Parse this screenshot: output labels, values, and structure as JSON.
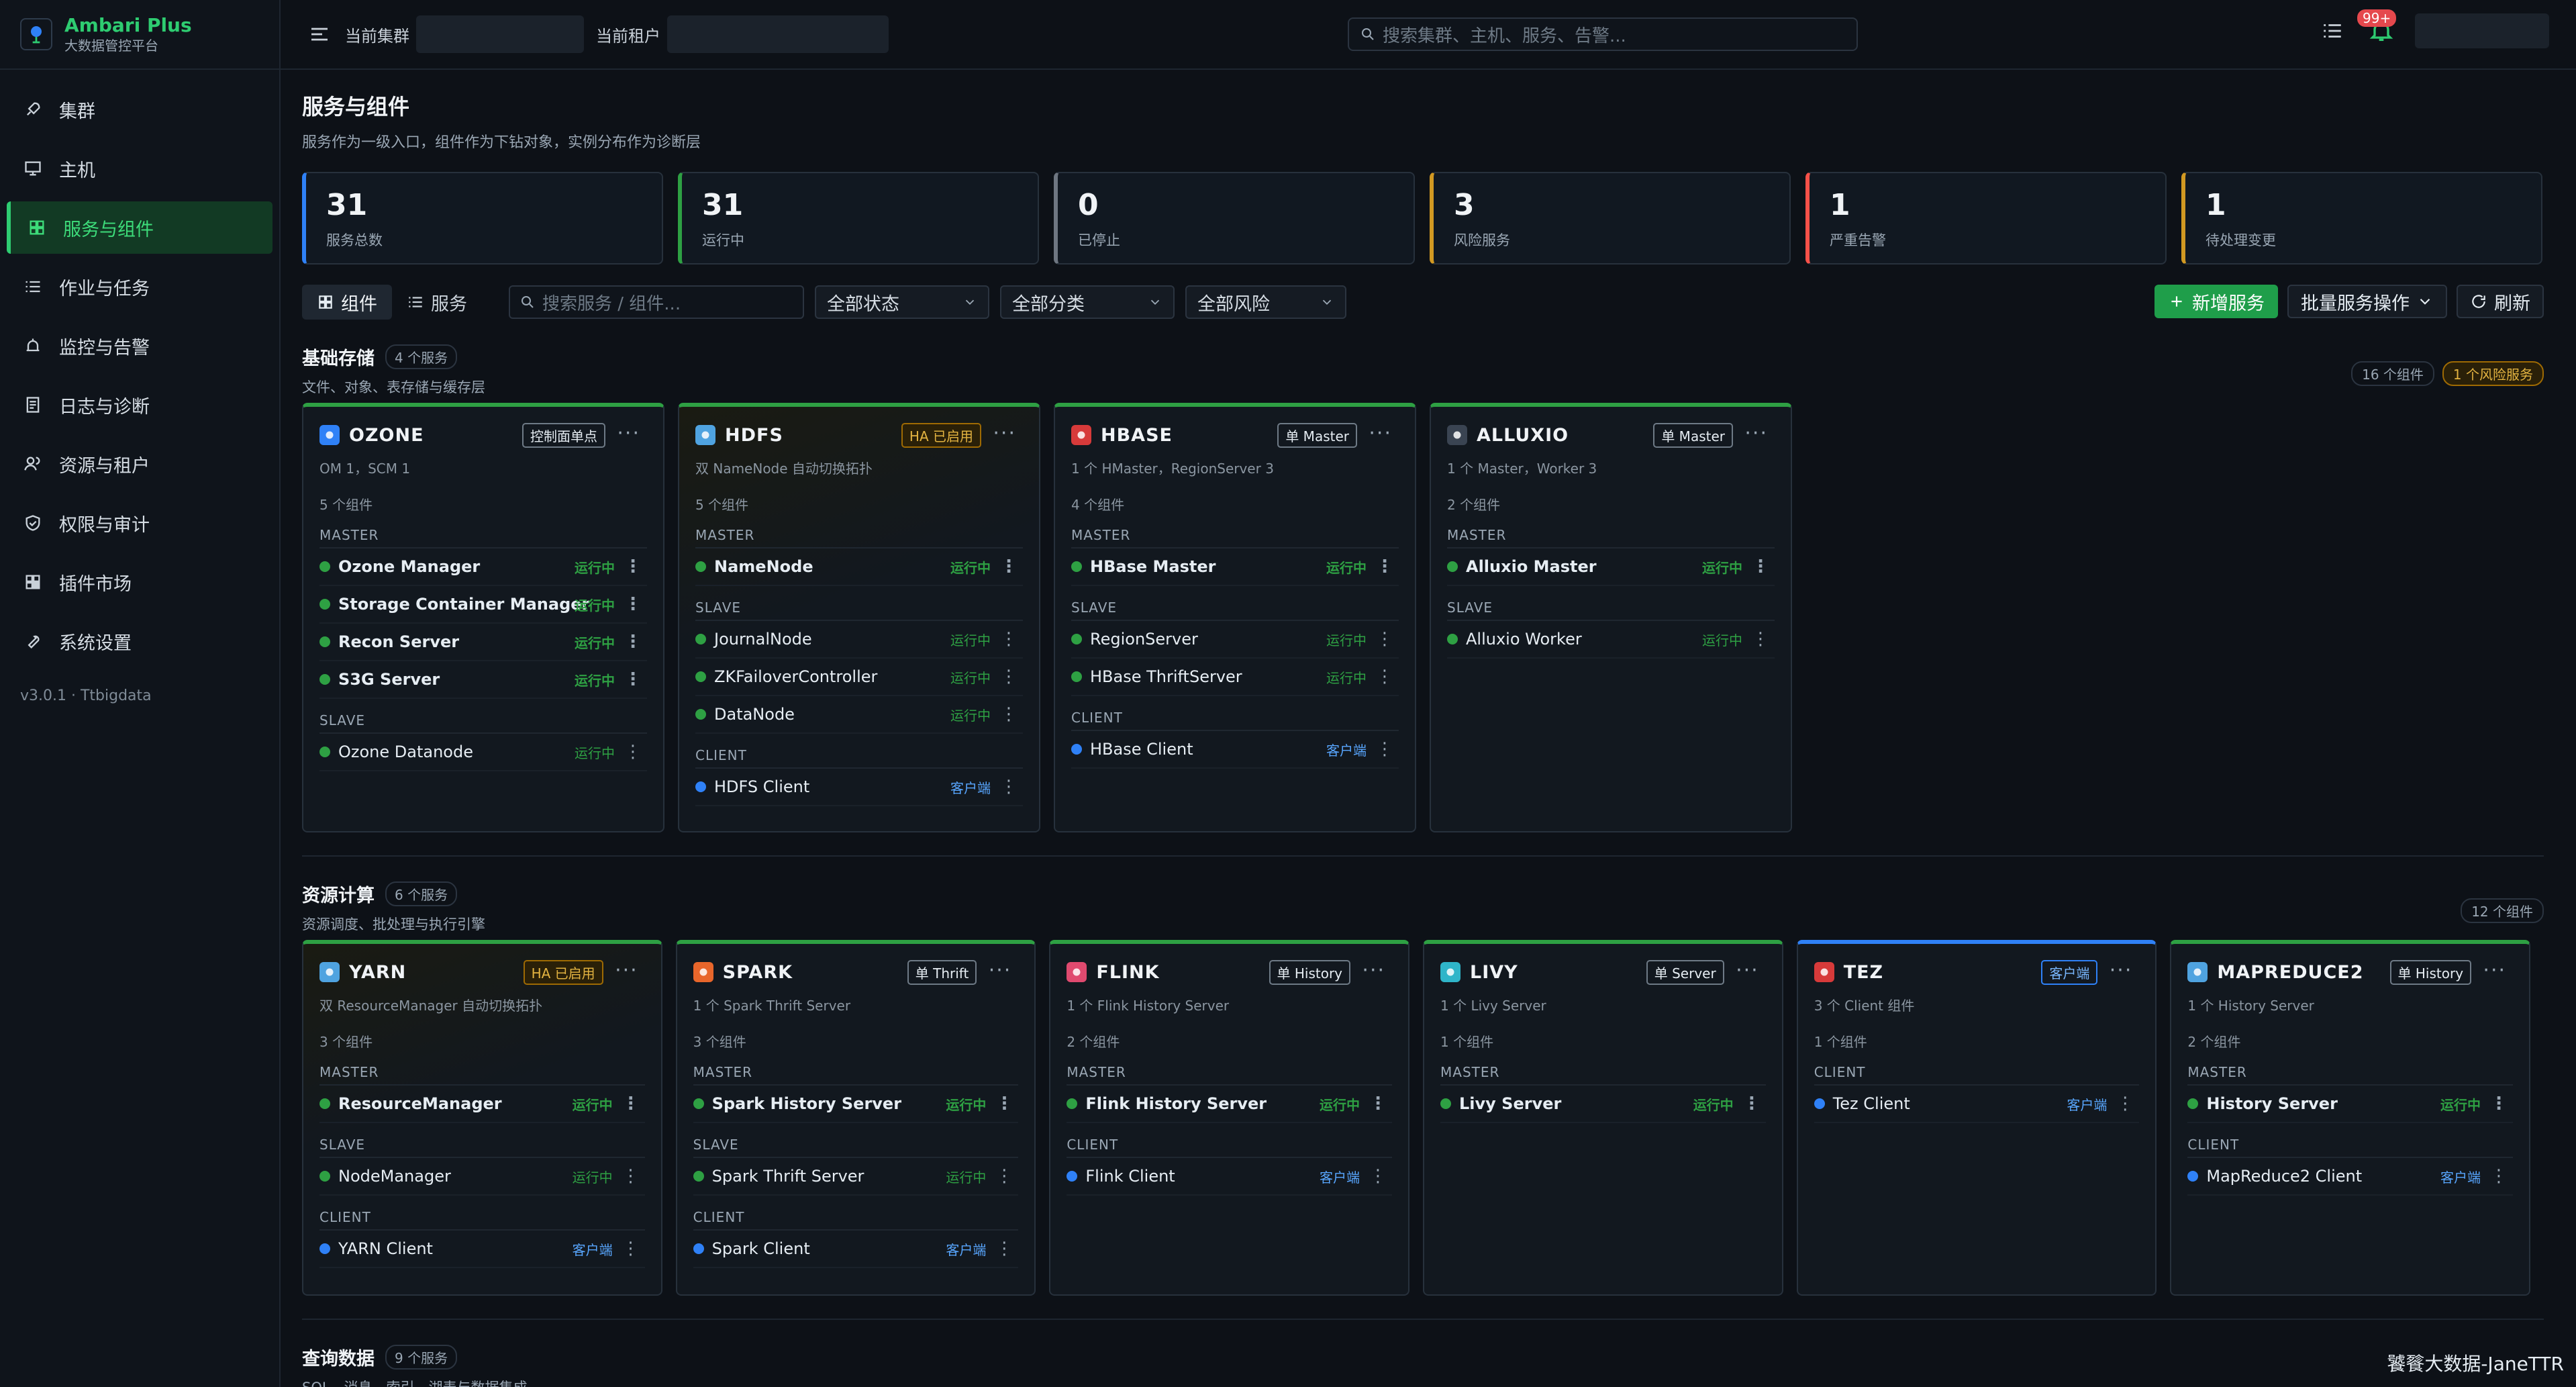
{
  "app": {
    "title": "Ambari Plus",
    "subtitle": "大数据管控平台",
    "version": "v3.0.1 · Ttbigdata"
  },
  "sidebar": {
    "items": [
      {
        "label": "集群",
        "icon": "rocket-icon"
      },
      {
        "label": "主机",
        "icon": "monitor-icon"
      },
      {
        "label": "服务与组件",
        "icon": "grid-icon",
        "active": true
      },
      {
        "label": "作业与任务",
        "icon": "list-icon"
      },
      {
        "label": "监控与告警",
        "icon": "alarm-icon"
      },
      {
        "label": "日志与诊断",
        "icon": "log-icon"
      },
      {
        "label": "资源与租户",
        "icon": "users-icon"
      },
      {
        "label": "权限与审计",
        "icon": "shield-icon"
      },
      {
        "label": "插件市场",
        "icon": "plugin-icon"
      },
      {
        "label": "系统设置",
        "icon": "wrench-icon"
      }
    ]
  },
  "topbar": {
    "cluster_label": "当前集群",
    "tenant_label": "当前租户",
    "search_placeholder": "搜索集群、主机、服务、告警...",
    "notify_count": "99+"
  },
  "page": {
    "title": "服务与组件",
    "subtitle": "服务作为一级入口，组件作为下钻对象，实例分布作为诊断层"
  },
  "stats": [
    {
      "value": "31",
      "label": "服务总数",
      "color": "#2f81f7"
    },
    {
      "value": "31",
      "label": "运行中",
      "color": "#2ea043"
    },
    {
      "value": "0",
      "label": "已停止",
      "color": "#6e7681"
    },
    {
      "value": "3",
      "label": "风险服务",
      "color": "#d29922"
    },
    {
      "value": "1",
      "label": "严重告警",
      "color": "#f85149"
    },
    {
      "value": "1",
      "label": "待处理变更",
      "color": "#d29922"
    }
  ],
  "toolbar": {
    "view_component": "组件",
    "view_service": "服务",
    "search_placeholder": "搜索服务 / 组件...",
    "status": "全部状态",
    "category": "全部分类",
    "risk": "全部风险",
    "add": "新增服务",
    "batch": "批量服务操作",
    "refresh": "刷新"
  },
  "sections": [
    {
      "title": "基础存储",
      "count": "4 个服务",
      "subtitle": "文件、对象、表存储与缓存层",
      "right_pills": [
        "16 个组件",
        "1 个风险服务"
      ],
      "cards": [
        {
          "name": "OZONE",
          "tag": "控制面单点",
          "tag_type": "normal",
          "desc": "OM 1，SCM 1",
          "count": "5 个组件",
          "icon_color": "#2f81f7",
          "ha": false,
          "groups": [
            {
              "name": "MASTER",
              "items": [
                {
                  "name": "Ozone Manager",
                  "status": "运行中"
                },
                {
                  "name": "Storage Container Manager",
                  "status": "运行中"
                },
                {
                  "name": "Recon Server",
                  "status": "运行中"
                },
                {
                  "name": "S3G Server",
                  "status": "运行中"
                }
              ]
            },
            {
              "name": "SLAVE",
              "items": [
                {
                  "name": "Ozone Datanode",
                  "status": "运行中"
                }
              ]
            }
          ]
        },
        {
          "name": "HDFS",
          "tag": "HA 已启用",
          "tag_type": "ha",
          "desc": "双 NameNode 自动切换拓扑",
          "count": "5 个组件",
          "icon_color": "#4fa3e0",
          "ha": true,
          "groups": [
            {
              "name": "MASTER",
              "items": [
                {
                  "name": "NameNode",
                  "status": "运行中"
                }
              ]
            },
            {
              "name": "SLAVE",
              "items": [
                {
                  "name": "JournalNode",
                  "status": "运行中"
                },
                {
                  "name": "ZKFailoverController",
                  "status": "运行中"
                },
                {
                  "name": "DataNode",
                  "status": "运行中"
                }
              ]
            },
            {
              "name": "CLIENT",
              "items": [
                {
                  "name": "HDFS Client",
                  "status": "客户端",
                  "client": true
                }
              ]
            }
          ]
        },
        {
          "name": "HBASE",
          "tag": "单 Master",
          "tag_type": "normal",
          "desc": "1 个 HMaster，RegionServer 3",
          "count": "4 个组件",
          "icon_color": "#d73a3a",
          "ha": false,
          "groups": [
            {
              "name": "MASTER",
              "items": [
                {
                  "name": "HBase Master",
                  "status": "运行中"
                }
              ]
            },
            {
              "name": "SLAVE",
              "items": [
                {
                  "name": "RegionServer",
                  "status": "运行中"
                },
                {
                  "name": "HBase ThriftServer",
                  "status": "运行中"
                }
              ]
            },
            {
              "name": "CLIENT",
              "items": [
                {
                  "name": "HBase Client",
                  "status": "客户端",
                  "client": true
                }
              ]
            }
          ]
        },
        {
          "name": "ALLUXIO",
          "tag": "单 Master",
          "tag_type": "normal",
          "desc": "1 个 Master，Worker 3",
          "count": "2 个组件",
          "icon_color": "#3a4452",
          "ha": false,
          "groups": [
            {
              "name": "MASTER",
              "items": [
                {
                  "name": "Alluxio Master",
                  "status": "运行中"
                }
              ]
            },
            {
              "name": "SLAVE",
              "items": [
                {
                  "name": "Alluxio Worker",
                  "status": "运行中"
                }
              ]
            }
          ]
        }
      ]
    },
    {
      "title": "资源计算",
      "count": "6 个服务",
      "subtitle": "资源调度、批处理与执行引擎",
      "right_pills": [
        "12 个组件"
      ],
      "cards": [
        {
          "name": "YARN",
          "tag": "HA 已启用",
          "tag_type": "ha",
          "desc": "双 ResourceManager 自动切换拓扑",
          "count": "3 个组件",
          "icon_color": "#4fa3e0",
          "ha": true,
          "groups": [
            {
              "name": "MASTER",
              "items": [
                {
                  "name": "ResourceManager",
                  "status": "运行中"
                }
              ]
            },
            {
              "name": "SLAVE",
              "items": [
                {
                  "name": "NodeManager",
                  "status": "运行中"
                }
              ]
            },
            {
              "name": "CLIENT",
              "items": [
                {
                  "name": "YARN Client",
                  "status": "客户端",
                  "client": true
                }
              ]
            }
          ]
        },
        {
          "name": "SPARK",
          "tag": "单 Thrift",
          "tag_type": "normal",
          "desc": "1 个 Spark Thrift Server",
          "count": "3 个组件",
          "icon_color": "#e8662b",
          "ha": false,
          "groups": [
            {
              "name": "MASTER",
              "items": [
                {
                  "name": "Spark History Server",
                  "status": "运行中"
                }
              ]
            },
            {
              "name": "SLAVE",
              "items": [
                {
                  "name": "Spark Thrift Server",
                  "status": "运行中"
                }
              ]
            },
            {
              "name": "CLIENT",
              "items": [
                {
                  "name": "Spark Client",
                  "status": "客户端",
                  "client": true
                }
              ]
            }
          ]
        },
        {
          "name": "FLINK",
          "tag": "单 History",
          "tag_type": "normal",
          "desc": "1 个 Flink History Server",
          "count": "2 个组件",
          "icon_color": "#e04a6f",
          "ha": false,
          "groups": [
            {
              "name": "MASTER",
              "items": [
                {
                  "name": "Flink History Server",
                  "status": "运行中"
                }
              ]
            },
            {
              "name": "CLIENT",
              "items": [
                {
                  "name": "Flink Client",
                  "status": "客户端",
                  "client": true
                }
              ]
            }
          ]
        },
        {
          "name": "LIVY",
          "tag": "单 Server",
          "tag_type": "normal",
          "desc": "1 个 Livy Server",
          "count": "1 个组件",
          "icon_color": "#2fb5c9",
          "ha": false,
          "groups": [
            {
              "name": "MASTER",
              "items": [
                {
                  "name": "Livy Server",
                  "status": "运行中"
                }
              ]
            }
          ]
        },
        {
          "name": "TEZ",
          "tag": "客户端",
          "tag_type": "client",
          "desc": "3 个 Client 组件",
          "count": "1 个组件",
          "icon_color": "#d73a3a",
          "ha": false,
          "blue_top": true,
          "groups": [
            {
              "name": "CLIENT",
              "items": [
                {
                  "name": "Tez Client",
                  "status": "客户端",
                  "client": true
                }
              ]
            }
          ]
        },
        {
          "name": "MAPREDUCE2",
          "tag": "单 History",
          "tag_type": "normal",
          "desc": "1 个 History Server",
          "count": "2 个组件",
          "icon_color": "#4fa3e0",
          "ha": false,
          "groups": [
            {
              "name": "MASTER",
              "items": [
                {
                  "name": "History Server",
                  "status": "运行中"
                }
              ]
            },
            {
              "name": "CLIENT",
              "items": [
                {
                  "name": "MapReduce2 Client",
                  "status": "客户端",
                  "client": true
                }
              ]
            }
          ]
        }
      ]
    },
    {
      "title": "查询数据",
      "count": "9 个服务",
      "subtitle": "SQL、消息、索引、湖表与数据集成",
      "right_pills": [],
      "cards": []
    }
  ],
  "watermark": "饕餮大数据-JaneTTR"
}
